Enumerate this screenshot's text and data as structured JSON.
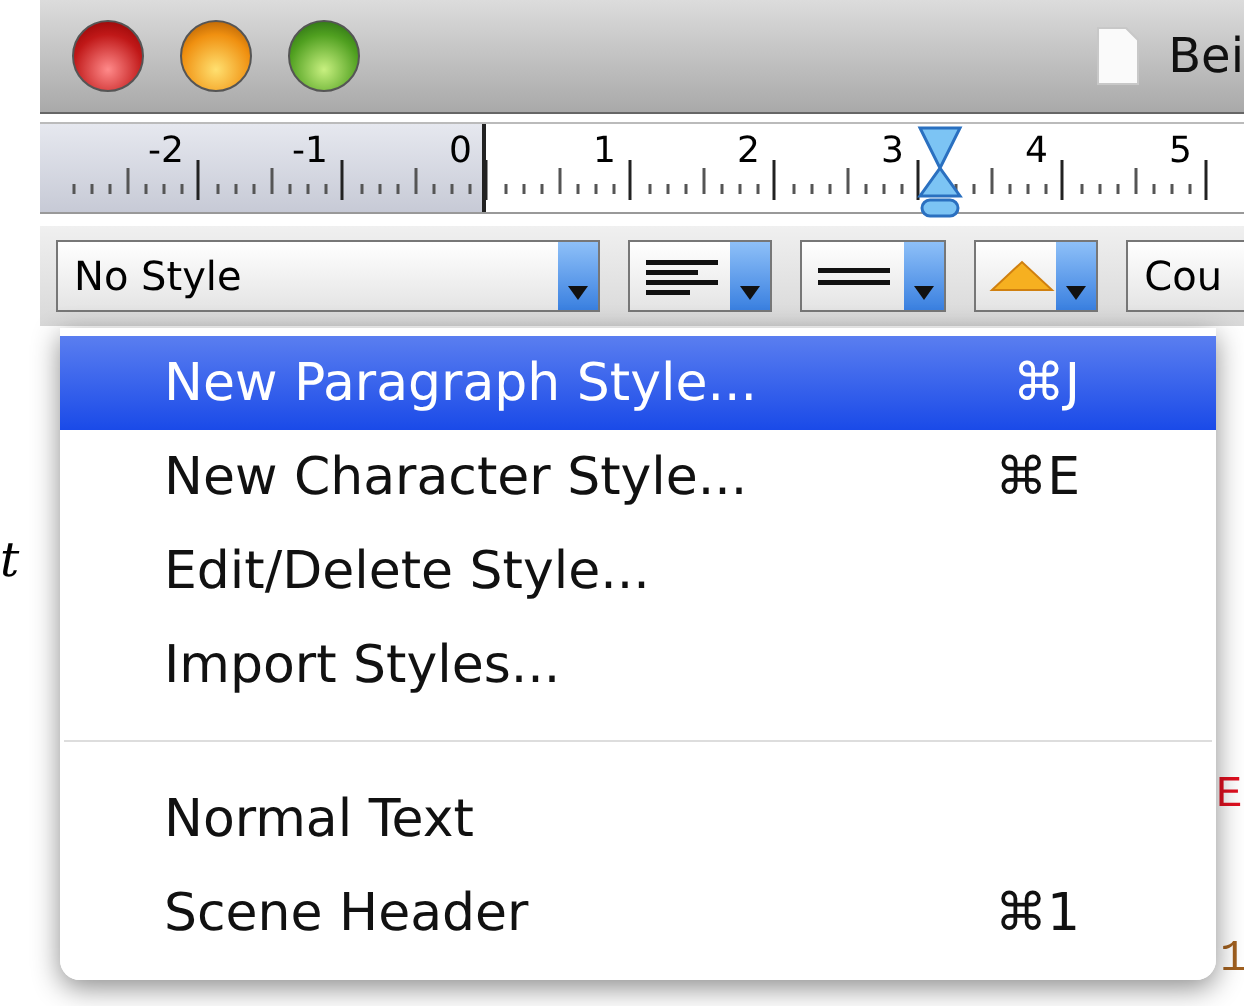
{
  "window": {
    "title": "Bei"
  },
  "ruler": {
    "labels": [
      "-2",
      "-1",
      "0",
      "1",
      "2",
      "3",
      "4",
      "5"
    ]
  },
  "toolbar": {
    "style_popup": "No Style",
    "font_popup": "Cou"
  },
  "menu": {
    "items": [
      {
        "kind": "item",
        "label": "New Paragraph Style...",
        "shortcut": "⌘J",
        "selected": true
      },
      {
        "kind": "item",
        "label": "New Character Style...",
        "shortcut": "⌘E",
        "selected": false
      },
      {
        "kind": "item",
        "label": "Edit/Delete Style...",
        "selected": false
      },
      {
        "kind": "item",
        "label": "Import Styles...",
        "selected": false
      },
      {
        "kind": "separator"
      },
      {
        "kind": "item",
        "label": "Normal Text",
        "selected": false
      },
      {
        "kind": "item",
        "label": "Scene Header",
        "shortcut": "⌘1",
        "selected": false
      }
    ]
  },
  "side_text": "t",
  "page_fragments": [
    {
      "text": "E",
      "color": "#e01020"
    },
    {
      "text": "1",
      "color": "#a06020"
    }
  ]
}
